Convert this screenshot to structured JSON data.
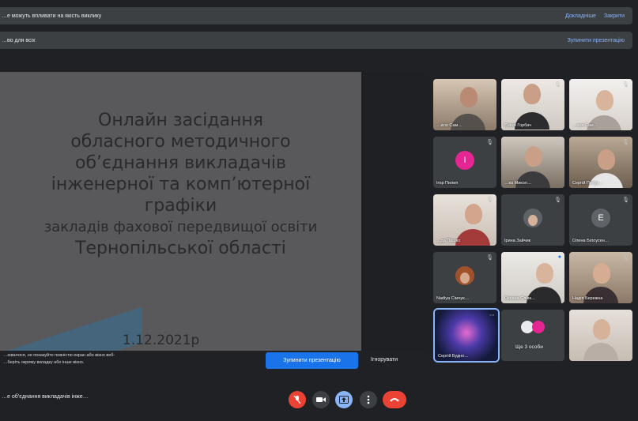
{
  "banner_top": {
    "message": "…е можуть впливати на якість виклику",
    "details": "Докладніше",
    "close": "Закрити"
  },
  "banner_present": {
    "message": "…во для всіх",
    "stop": "Зупинити презентацію"
  },
  "slide": {
    "title_lines": [
      "Онлайн засідання",
      "обласного методичного",
      "об’єднання викладачів",
      "інженерної та комп’ютерної",
      "графіки",
      "закладів фахової передвищої освіти",
      "Тернопільської області"
    ],
    "date": "1.12.2021р"
  },
  "share_warning": {
    "line1": "…ювалося, не показуйте повністю екран або вікно веб-",
    "line2": "…беріть окрему вкладку або інше вікно.",
    "stop_button": "Зупинити презентацію",
    "ignore_button": "Ігнорувати"
  },
  "participants": [
    {
      "name": "…ило Сам…",
      "type": "photo"
    },
    {
      "name": "Євген Горбач",
      "type": "photo"
    },
    {
      "name": "…ася Сам…",
      "type": "photo"
    },
    {
      "name": "Ігор Пилип",
      "type": "avatar",
      "initial": "І",
      "color": "#e52592"
    },
    {
      "name": "…ка Микол…",
      "type": "photo"
    },
    {
      "name": "Сергій Петру…",
      "type": "photo"
    },
    {
      "name": "…да Пашко",
      "type": "photo"
    },
    {
      "name": "Ірина Зайчик",
      "type": "avatar_img",
      "initial": "",
      "color": "#5f6368"
    },
    {
      "name": "Олена Білоусен…",
      "type": "avatar",
      "initial": "E",
      "color": "#5f6368"
    },
    {
      "name": "Nadiya Сімчук…",
      "type": "avatar_img",
      "initial": "",
      "color": "#a0522d"
    },
    {
      "name": "Оксана Слівк…",
      "type": "photo"
    },
    {
      "name": "Надія Бережна",
      "type": "photo"
    },
    {
      "name": "Сергій Будно…",
      "type": "photo"
    },
    {
      "name": "Ще 3 особи",
      "type": "group"
    },
    {
      "name": "",
      "type": "photo"
    }
  ],
  "meeting": {
    "name": "…е об’єднання викладачів інже…"
  },
  "icons": {
    "mic": "mic-off-icon",
    "cam": "camera-icon",
    "present": "present-icon",
    "more": "more-vert-icon",
    "leave": "end-call-icon"
  }
}
